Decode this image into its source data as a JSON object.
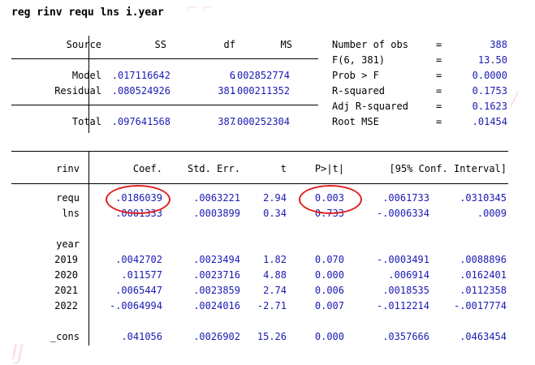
{
  "command": "reg rinv requ lns i.year",
  "anova": {
    "headers": {
      "source": "Source",
      "ss": "SS",
      "df": "df",
      "ms": "MS"
    },
    "rows": [
      {
        "source": "Model",
        "ss": ".017116642",
        "df": "6",
        "ms": ".002852774"
      },
      {
        "source": "Residual",
        "ss": ".080524926",
        "df": "381",
        "ms": ".000211352"
      },
      {
        "source": "Total",
        "ss": ".097641568",
        "df": "387",
        "ms": ".000252304"
      }
    ]
  },
  "stats": [
    {
      "label": "Number of obs",
      "eq": "=",
      "value": "388"
    },
    {
      "label": "F(6, 381)",
      "eq": "=",
      "value": "13.50"
    },
    {
      "label": "Prob > F",
      "eq": "=",
      "value": "0.0000"
    },
    {
      "label": "R-squared",
      "eq": "=",
      "value": "0.1753"
    },
    {
      "label": "Adj R-squared",
      "eq": "=",
      "value": "0.1623"
    },
    {
      "label": "Root MSE",
      "eq": "=",
      "value": ".01454"
    }
  ],
  "coef_table": {
    "headers": {
      "var": "rinv",
      "coef": "Coef.",
      "se": "Std. Err.",
      "t": "t",
      "p": "P>|t|",
      "ci": "[95% Conf. Interval]"
    },
    "rows": [
      {
        "var": "requ",
        "coef": ".0186039",
        "se": ".0063221",
        "t": "2.94",
        "p": "0.003",
        "lo": ".0061733",
        "hi": ".0310345"
      },
      {
        "var": "lns",
        "coef": ".0001333",
        "se": ".0003899",
        "t": "0.34",
        "p": "0.733",
        "lo": "-.0006334",
        "hi": ".0009"
      },
      {
        "var": "year",
        "coef": "",
        "se": "",
        "t": "",
        "p": "",
        "lo": "",
        "hi": ""
      },
      {
        "var": "2019",
        "coef": ".0042702",
        "se": ".0023494",
        "t": "1.82",
        "p": "0.070",
        "lo": "-.0003491",
        "hi": ".0088896"
      },
      {
        "var": "2020",
        "coef": ".011577",
        "se": ".0023716",
        "t": "4.88",
        "p": "0.000",
        "lo": ".006914",
        "hi": ".0162401"
      },
      {
        "var": "2021",
        "coef": ".0065447",
        "se": ".0023859",
        "t": "2.74",
        "p": "0.006",
        "lo": ".0018535",
        "hi": ".0112358"
      },
      {
        "var": "2022",
        "coef": "-.0064994",
        "se": ".0024016",
        "t": "-2.71",
        "p": "0.007",
        "lo": "-.0112214",
        "hi": "-.0017774"
      },
      {
        "var": "_cons",
        "coef": ".041056",
        "se": ".0026902",
        "t": "15.26",
        "p": "0.000",
        "lo": ".0357666",
        "hi": ".0463454"
      }
    ]
  },
  "highlight_color": "#e0201e"
}
